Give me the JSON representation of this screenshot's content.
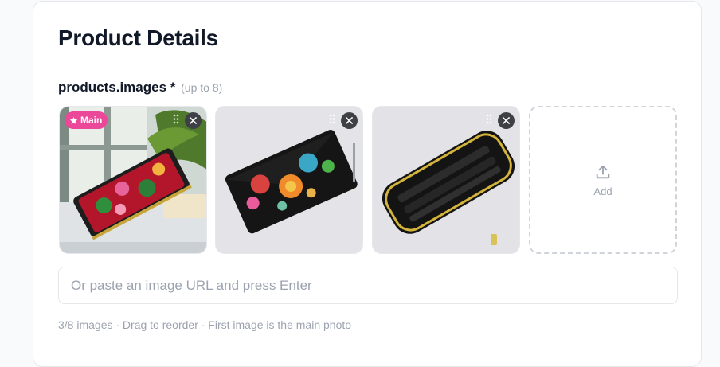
{
  "section": {
    "title": "Product Details"
  },
  "images_field": {
    "label": "products.images",
    "required_mark": "*",
    "hint": "(up to 8)"
  },
  "images": [
    {
      "badge": "Main",
      "icon": "star-icon"
    },
    {
      "icon": "wallet-photo"
    },
    {
      "icon": "wallet-photo"
    }
  ],
  "add_tile": {
    "label": "Add",
    "icon": "upload-icon"
  },
  "url_input": {
    "placeholder": "Or paste an image URL and press Enter",
    "value": ""
  },
  "helper_text": "3/8 images · Drag to reorder · First image is the main photo",
  "colors": {
    "accent": "#ec4899",
    "remove_button": "#3f3f46",
    "text": "#111827",
    "muted": "#9ca3af"
  }
}
